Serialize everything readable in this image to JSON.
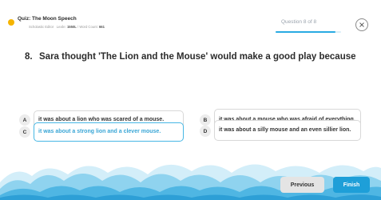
{
  "header": {
    "quiz_title": "Quiz: The Moon Speech",
    "publisher": "Scholastic Editor",
    "level_label": "Lexile:",
    "level_value": "1550L",
    "word_count_label": "/ Word Count:",
    "word_count_value": "661",
    "progress_label": "Question 8 of 8",
    "progress_fraction": 0.92
  },
  "question": {
    "number": "8.",
    "text": "Sara thought 'The Lion and the Mouse' would make a good play because"
  },
  "options": [
    {
      "letter": "A",
      "text": "it was about a lion who was scared of a mouse."
    },
    {
      "letter": "B",
      "text": "it was about a mouse who was afraid of everything."
    },
    {
      "letter": "C",
      "text": "it was about a strong lion and a clever mouse.",
      "selected": true
    },
    {
      "letter": "D",
      "text": "it was about a silly mouse and an even sillier lion."
    }
  ],
  "buttons": {
    "previous": "Previous",
    "finish": "Finish"
  },
  "icons": {
    "quiz": "quiz-badge-icon",
    "close": "close-icon"
  },
  "colors": {
    "accent": "#29abe2",
    "selected_border": "#47b7e4",
    "quiz_badge": "#f5b400",
    "finish_button": "#1e9fd8"
  }
}
